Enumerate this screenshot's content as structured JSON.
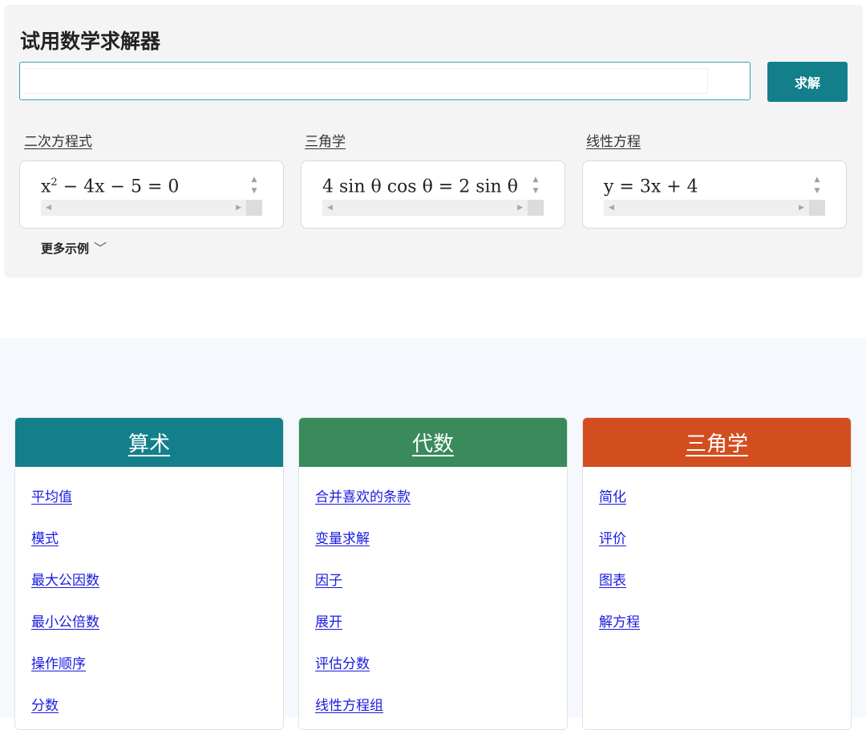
{
  "solver": {
    "title": "试用数学求解器",
    "input_value": "",
    "solve_label": "求解",
    "more_examples": "更多示例",
    "examples": [
      {
        "category": "二次方程式",
        "base": "x",
        "exp": "2",
        "rest": " − 4x − 5 = 0"
      },
      {
        "category": "三角学",
        "base": "4 sin θ cos θ = 2 sin θ",
        "exp": "",
        "rest": ""
      },
      {
        "category": "线性方程",
        "base": "y = 3x + 4",
        "exp": "",
        "rest": ""
      }
    ]
  },
  "topics": [
    {
      "title": "算术",
      "color": "#137f8b",
      "links": [
        "平均值",
        "模式",
        "最大公因数",
        "最小公倍数",
        "操作顺序",
        "分数"
      ]
    },
    {
      "title": "代数",
      "color": "#3a8a5c",
      "links": [
        "合并喜欢的条款",
        "变量求解",
        "因子",
        "展开",
        "评估分数",
        "线性方程组"
      ]
    },
    {
      "title": "三角学",
      "color": "#d24e1e",
      "links": [
        "简化",
        "评价",
        "图表",
        "解方程"
      ]
    }
  ]
}
